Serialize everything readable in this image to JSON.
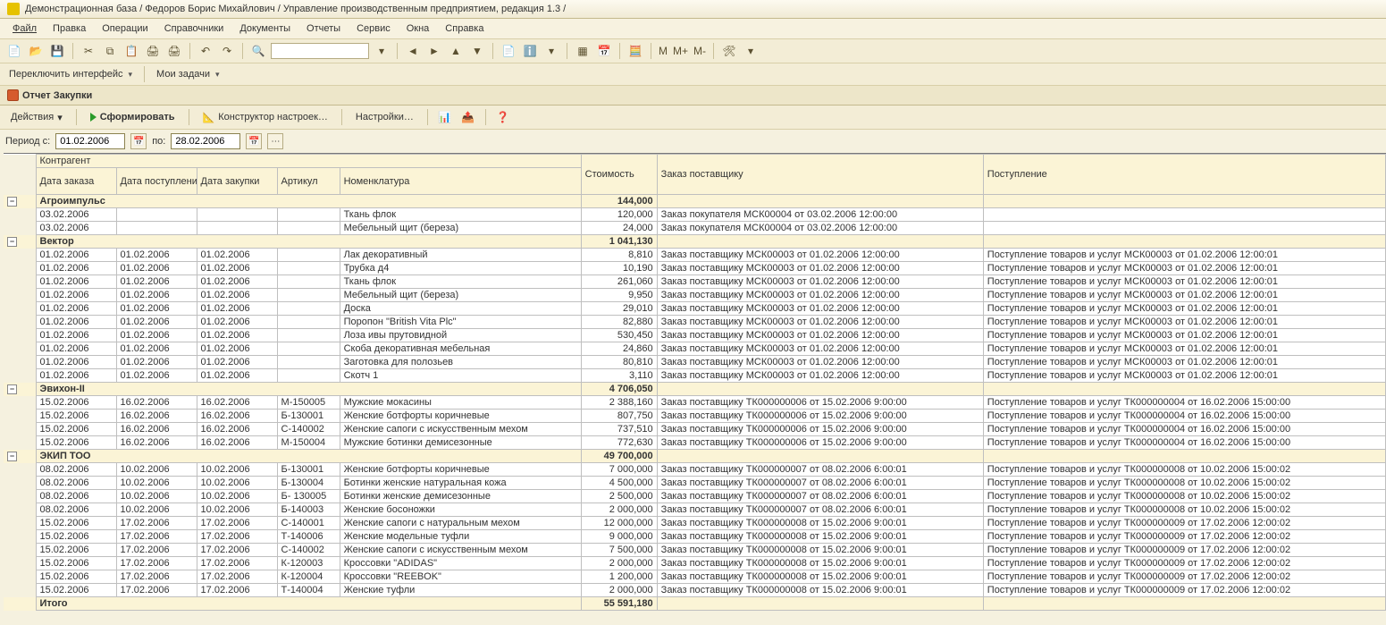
{
  "title": "Демонстрационная база / Федоров Борис Михайлович / Управление производственным предприятием, редакция 1.3 /",
  "menu": [
    "Файл",
    "Правка",
    "Операции",
    "Справочники",
    "Документы",
    "Отчеты",
    "Сервис",
    "Окна",
    "Справка"
  ],
  "subtoolbar": {
    "switch_interface": "Переключить интерфейс",
    "my_tasks": "Мои задачи"
  },
  "doc_tab": "Отчет  Закупки",
  "report_toolbar": {
    "actions": "Действия",
    "generate": "Сформировать",
    "constructor": "Конструктор настроек…",
    "settings": "Настройки…"
  },
  "period": {
    "label_from": "Период с:",
    "from": "01.02.2006",
    "label_to": "по:",
    "to": "28.02.2006"
  },
  "headers": {
    "kontragent": "Контрагент",
    "order_date": "Дата заказа",
    "arrival_date": "Дата поступления",
    "purchase_date": "Дата закупки",
    "artikul": "Артикул",
    "nomenklatura": "Номенклатура",
    "cost": "Стоимость",
    "supplier_order": "Заказ поставщику",
    "receipt": "Поступление",
    "total": "Итого"
  },
  "groups": [
    {
      "name": "Агроимпульс",
      "cost": "144,000",
      "rows": [
        {
          "d1": "03.02.2006",
          "d2": "",
          "d3": "",
          "art": "",
          "nom": "Ткань флок",
          "cost": "120,000",
          "order": "Заказ покупателя МСК00004 от 03.02.2006 12:00:00",
          "recv": ""
        },
        {
          "d1": "03.02.2006",
          "d2": "",
          "d3": "",
          "art": "",
          "nom": "Мебельный щит (береза)",
          "cost": "24,000",
          "order": "Заказ покупателя МСК00004 от 03.02.2006 12:00:00",
          "recv": ""
        }
      ]
    },
    {
      "name": "Вектор",
      "cost": "1 041,130",
      "rows": [
        {
          "d1": "01.02.2006",
          "d2": "01.02.2006",
          "d3": "01.02.2006",
          "art": "",
          "nom": "Лак декоративный",
          "cost": "8,810",
          "order": "Заказ поставщику МСК00003 от 01.02.2006 12:00:00",
          "recv": "Поступление товаров и услуг МСК00003 от 01.02.2006 12:00:01"
        },
        {
          "d1": "01.02.2006",
          "d2": "01.02.2006",
          "d3": "01.02.2006",
          "art": "",
          "nom": "Трубка д4",
          "cost": "10,190",
          "order": "Заказ поставщику МСК00003 от 01.02.2006 12:00:00",
          "recv": "Поступление товаров и услуг МСК00003 от 01.02.2006 12:00:01"
        },
        {
          "d1": "01.02.2006",
          "d2": "01.02.2006",
          "d3": "01.02.2006",
          "art": "",
          "nom": "Ткань флок",
          "cost": "261,060",
          "order": "Заказ поставщику МСК00003 от 01.02.2006 12:00:00",
          "recv": "Поступление товаров и услуг МСК00003 от 01.02.2006 12:00:01"
        },
        {
          "d1": "01.02.2006",
          "d2": "01.02.2006",
          "d3": "01.02.2006",
          "art": "",
          "nom": "Мебельный щит (береза)",
          "cost": "9,950",
          "order": "Заказ поставщику МСК00003 от 01.02.2006 12:00:00",
          "recv": "Поступление товаров и услуг МСК00003 от 01.02.2006 12:00:01"
        },
        {
          "d1": "01.02.2006",
          "d2": "01.02.2006",
          "d3": "01.02.2006",
          "art": "",
          "nom": "Доска",
          "cost": "29,010",
          "order": "Заказ поставщику МСК00003 от 01.02.2006 12:00:00",
          "recv": "Поступление товаров и услуг МСК00003 от 01.02.2006 12:00:01"
        },
        {
          "d1": "01.02.2006",
          "d2": "01.02.2006",
          "d3": "01.02.2006",
          "art": "",
          "nom": "Поропон \"British Vita Plc\"",
          "cost": "82,880",
          "order": "Заказ поставщику МСК00003 от 01.02.2006 12:00:00",
          "recv": "Поступление товаров и услуг МСК00003 от 01.02.2006 12:00:01"
        },
        {
          "d1": "01.02.2006",
          "d2": "01.02.2006",
          "d3": "01.02.2006",
          "art": "",
          "nom": "Лоза ивы прутовидной",
          "cost": "530,450",
          "order": "Заказ поставщику МСК00003 от 01.02.2006 12:00:00",
          "recv": "Поступление товаров и услуг МСК00003 от 01.02.2006 12:00:01"
        },
        {
          "d1": "01.02.2006",
          "d2": "01.02.2006",
          "d3": "01.02.2006",
          "art": "",
          "nom": "Скоба декоративная мебельная",
          "cost": "24,860",
          "order": "Заказ поставщику МСК00003 от 01.02.2006 12:00:00",
          "recv": "Поступление товаров и услуг МСК00003 от 01.02.2006 12:00:01"
        },
        {
          "d1": "01.02.2006",
          "d2": "01.02.2006",
          "d3": "01.02.2006",
          "art": "",
          "nom": "Заготовка для полозьев",
          "cost": "80,810",
          "order": "Заказ поставщику МСК00003 от 01.02.2006 12:00:00",
          "recv": "Поступление товаров и услуг МСК00003 от 01.02.2006 12:00:01"
        },
        {
          "d1": "01.02.2006",
          "d2": "01.02.2006",
          "d3": "01.02.2006",
          "art": "",
          "nom": "Скотч 1",
          "cost": "3,110",
          "order": "Заказ поставщику МСК00003 от 01.02.2006 12:00:00",
          "recv": "Поступление товаров и услуг МСК00003 от 01.02.2006 12:00:01"
        }
      ]
    },
    {
      "name": "Эвихон-II",
      "cost": "4 706,050",
      "rows": [
        {
          "d1": "15.02.2006",
          "d2": "16.02.2006",
          "d3": "16.02.2006",
          "art": "М-150005",
          "nom": "Мужские мокасины",
          "cost": "2 388,160",
          "order": "Заказ поставщику ТК000000006 от 15.02.2006 9:00:00",
          "recv": "Поступление товаров и услуг ТК000000004 от 16.02.2006 15:00:00"
        },
        {
          "d1": "15.02.2006",
          "d2": "16.02.2006",
          "d3": "16.02.2006",
          "art": "Б-130001",
          "nom": "Женские ботфорты коричневые",
          "cost": "807,750",
          "order": "Заказ поставщику ТК000000006 от 15.02.2006 9:00:00",
          "recv": "Поступление товаров и услуг ТК000000004 от 16.02.2006 15:00:00"
        },
        {
          "d1": "15.02.2006",
          "d2": "16.02.2006",
          "d3": "16.02.2006",
          "art": "С-140002",
          "nom": "Женские сапоги с искусственным мехом",
          "cost": "737,510",
          "order": "Заказ поставщику ТК000000006 от 15.02.2006 9:00:00",
          "recv": "Поступление товаров и услуг ТК000000004 от 16.02.2006 15:00:00"
        },
        {
          "d1": "15.02.2006",
          "d2": "16.02.2006",
          "d3": "16.02.2006",
          "art": "М-150004",
          "nom": "Мужские ботинки демисезонные",
          "cost": "772,630",
          "order": "Заказ поставщику ТК000000006 от 15.02.2006 9:00:00",
          "recv": "Поступление товаров и услуг ТК000000004 от 16.02.2006 15:00:00"
        }
      ]
    },
    {
      "name": "ЭКИП ТОО",
      "cost": "49 700,000",
      "rows": [
        {
          "d1": "08.02.2006",
          "d2": "10.02.2006",
          "d3": "10.02.2006",
          "art": "Б-130001",
          "nom": "Женские ботфорты коричневые",
          "cost": "7 000,000",
          "order": "Заказ поставщику ТК000000007 от 08.02.2006 6:00:01",
          "recv": "Поступление товаров и услуг ТК000000008 от 10.02.2006 15:00:02"
        },
        {
          "d1": "08.02.2006",
          "d2": "10.02.2006",
          "d3": "10.02.2006",
          "art": "Б-130004",
          "nom": "Ботинки женские натуральная кожа",
          "cost": "4 500,000",
          "order": "Заказ поставщику ТК000000007 от 08.02.2006 6:00:01",
          "recv": "Поступление товаров и услуг ТК000000008 от 10.02.2006 15:00:02"
        },
        {
          "d1": "08.02.2006",
          "d2": "10.02.2006",
          "d3": "10.02.2006",
          "art": "Б- 130005",
          "nom": "Ботинки женские демисезонные",
          "cost": "2 500,000",
          "order": "Заказ поставщику ТК000000007 от 08.02.2006 6:00:01",
          "recv": "Поступление товаров и услуг ТК000000008 от 10.02.2006 15:00:02"
        },
        {
          "d1": "08.02.2006",
          "d2": "10.02.2006",
          "d3": "10.02.2006",
          "art": "Б-140003",
          "nom": "Женские босоножки",
          "cost": "2 000,000",
          "order": "Заказ поставщику ТК000000007 от 08.02.2006 6:00:01",
          "recv": "Поступление товаров и услуг ТК000000008 от 10.02.2006 15:00:02"
        },
        {
          "d1": "15.02.2006",
          "d2": "17.02.2006",
          "d3": "17.02.2006",
          "art": "С-140001",
          "nom": "Женские сапоги с натуральным мехом",
          "cost": "12 000,000",
          "order": "Заказ поставщику ТК000000008 от 15.02.2006 9:00:01",
          "recv": "Поступление товаров и услуг ТК000000009 от 17.02.2006 12:00:02"
        },
        {
          "d1": "15.02.2006",
          "d2": "17.02.2006",
          "d3": "17.02.2006",
          "art": "Т-140006",
          "nom": "Женские модельные туфли",
          "cost": "9 000,000",
          "order": "Заказ поставщику ТК000000008 от 15.02.2006 9:00:01",
          "recv": "Поступление товаров и услуг ТК000000009 от 17.02.2006 12:00:02"
        },
        {
          "d1": "15.02.2006",
          "d2": "17.02.2006",
          "d3": "17.02.2006",
          "art": "С-140002",
          "nom": "Женские сапоги с искусственным мехом",
          "cost": "7 500,000",
          "order": "Заказ поставщику ТК000000008 от 15.02.2006 9:00:01",
          "recv": "Поступление товаров и услуг ТК000000009 от 17.02.2006 12:00:02"
        },
        {
          "d1": "15.02.2006",
          "d2": "17.02.2006",
          "d3": "17.02.2006",
          "art": "К-120003",
          "nom": "Кроссовки \"ADIDAS\"",
          "cost": "2 000,000",
          "order": "Заказ поставщику ТК000000008 от 15.02.2006 9:00:01",
          "recv": "Поступление товаров и услуг ТК000000009 от 17.02.2006 12:00:02"
        },
        {
          "d1": "15.02.2006",
          "d2": "17.02.2006",
          "d3": "17.02.2006",
          "art": "К-120004",
          "nom": "Кроссовки \"REEBOK\"",
          "cost": "1 200,000",
          "order": "Заказ поставщику ТК000000008 от 15.02.2006 9:00:01",
          "recv": "Поступление товаров и услуг ТК000000009 от 17.02.2006 12:00:02"
        },
        {
          "d1": "15.02.2006",
          "d2": "17.02.2006",
          "d3": "17.02.2006",
          "art": "Т-140004",
          "nom": "Женские туфли",
          "cost": "2 000,000",
          "order": "Заказ поставщику ТК000000008 от 15.02.2006 9:00:01",
          "recv": "Поступление товаров и услуг ТК000000009 от 17.02.2006 12:00:02"
        }
      ]
    }
  ],
  "grand_total": "55 591,180",
  "m_labels": {
    "m": "М",
    "mp": "М+",
    "mm": "М-"
  }
}
